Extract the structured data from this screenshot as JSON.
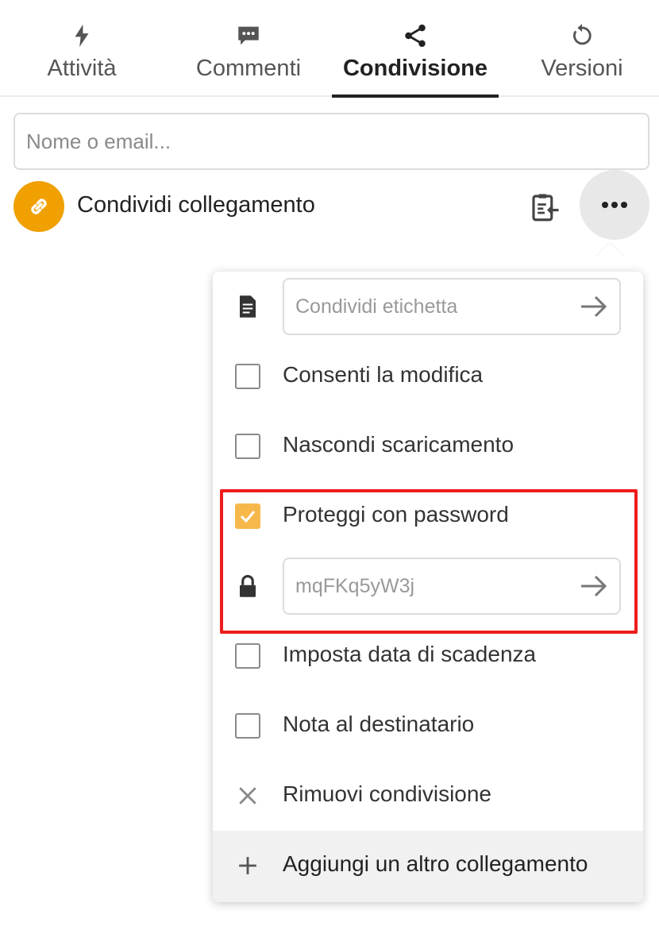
{
  "tabs": [
    {
      "label": "Attività",
      "icon": "lightning-icon"
    },
    {
      "label": "Commenti",
      "icon": "comment-icon"
    },
    {
      "label": "Condivisione",
      "icon": "share-icon",
      "active": true
    },
    {
      "label": "Versioni",
      "icon": "history-icon"
    }
  ],
  "search": {
    "placeholder": "Nome o email..."
  },
  "share_link": {
    "label": "Condividi collegamento",
    "avatar_color": "#f0a000"
  },
  "menu": {
    "label_field": {
      "placeholder": "Condividi etichetta"
    },
    "allow_edit": {
      "label": "Consenti la modifica",
      "checked": false
    },
    "hide_download": {
      "label": "Nascondi scaricamento",
      "checked": false
    },
    "password_protect": {
      "label": "Proteggi con password",
      "checked": true
    },
    "password_field": {
      "value": "mqFKq5yW3j"
    },
    "expiry": {
      "label": "Imposta data di scadenza",
      "checked": false
    },
    "note": {
      "label": "Nota al destinatario",
      "checked": false
    },
    "remove": {
      "label": "Rimuovi condivisione"
    },
    "add_link": {
      "label": "Aggiungi un altro collegamento"
    }
  },
  "colors": {
    "accent_checkbox": "#f7b84b",
    "highlight": "#ee1c1c",
    "link_avatar": "#f0a000"
  }
}
